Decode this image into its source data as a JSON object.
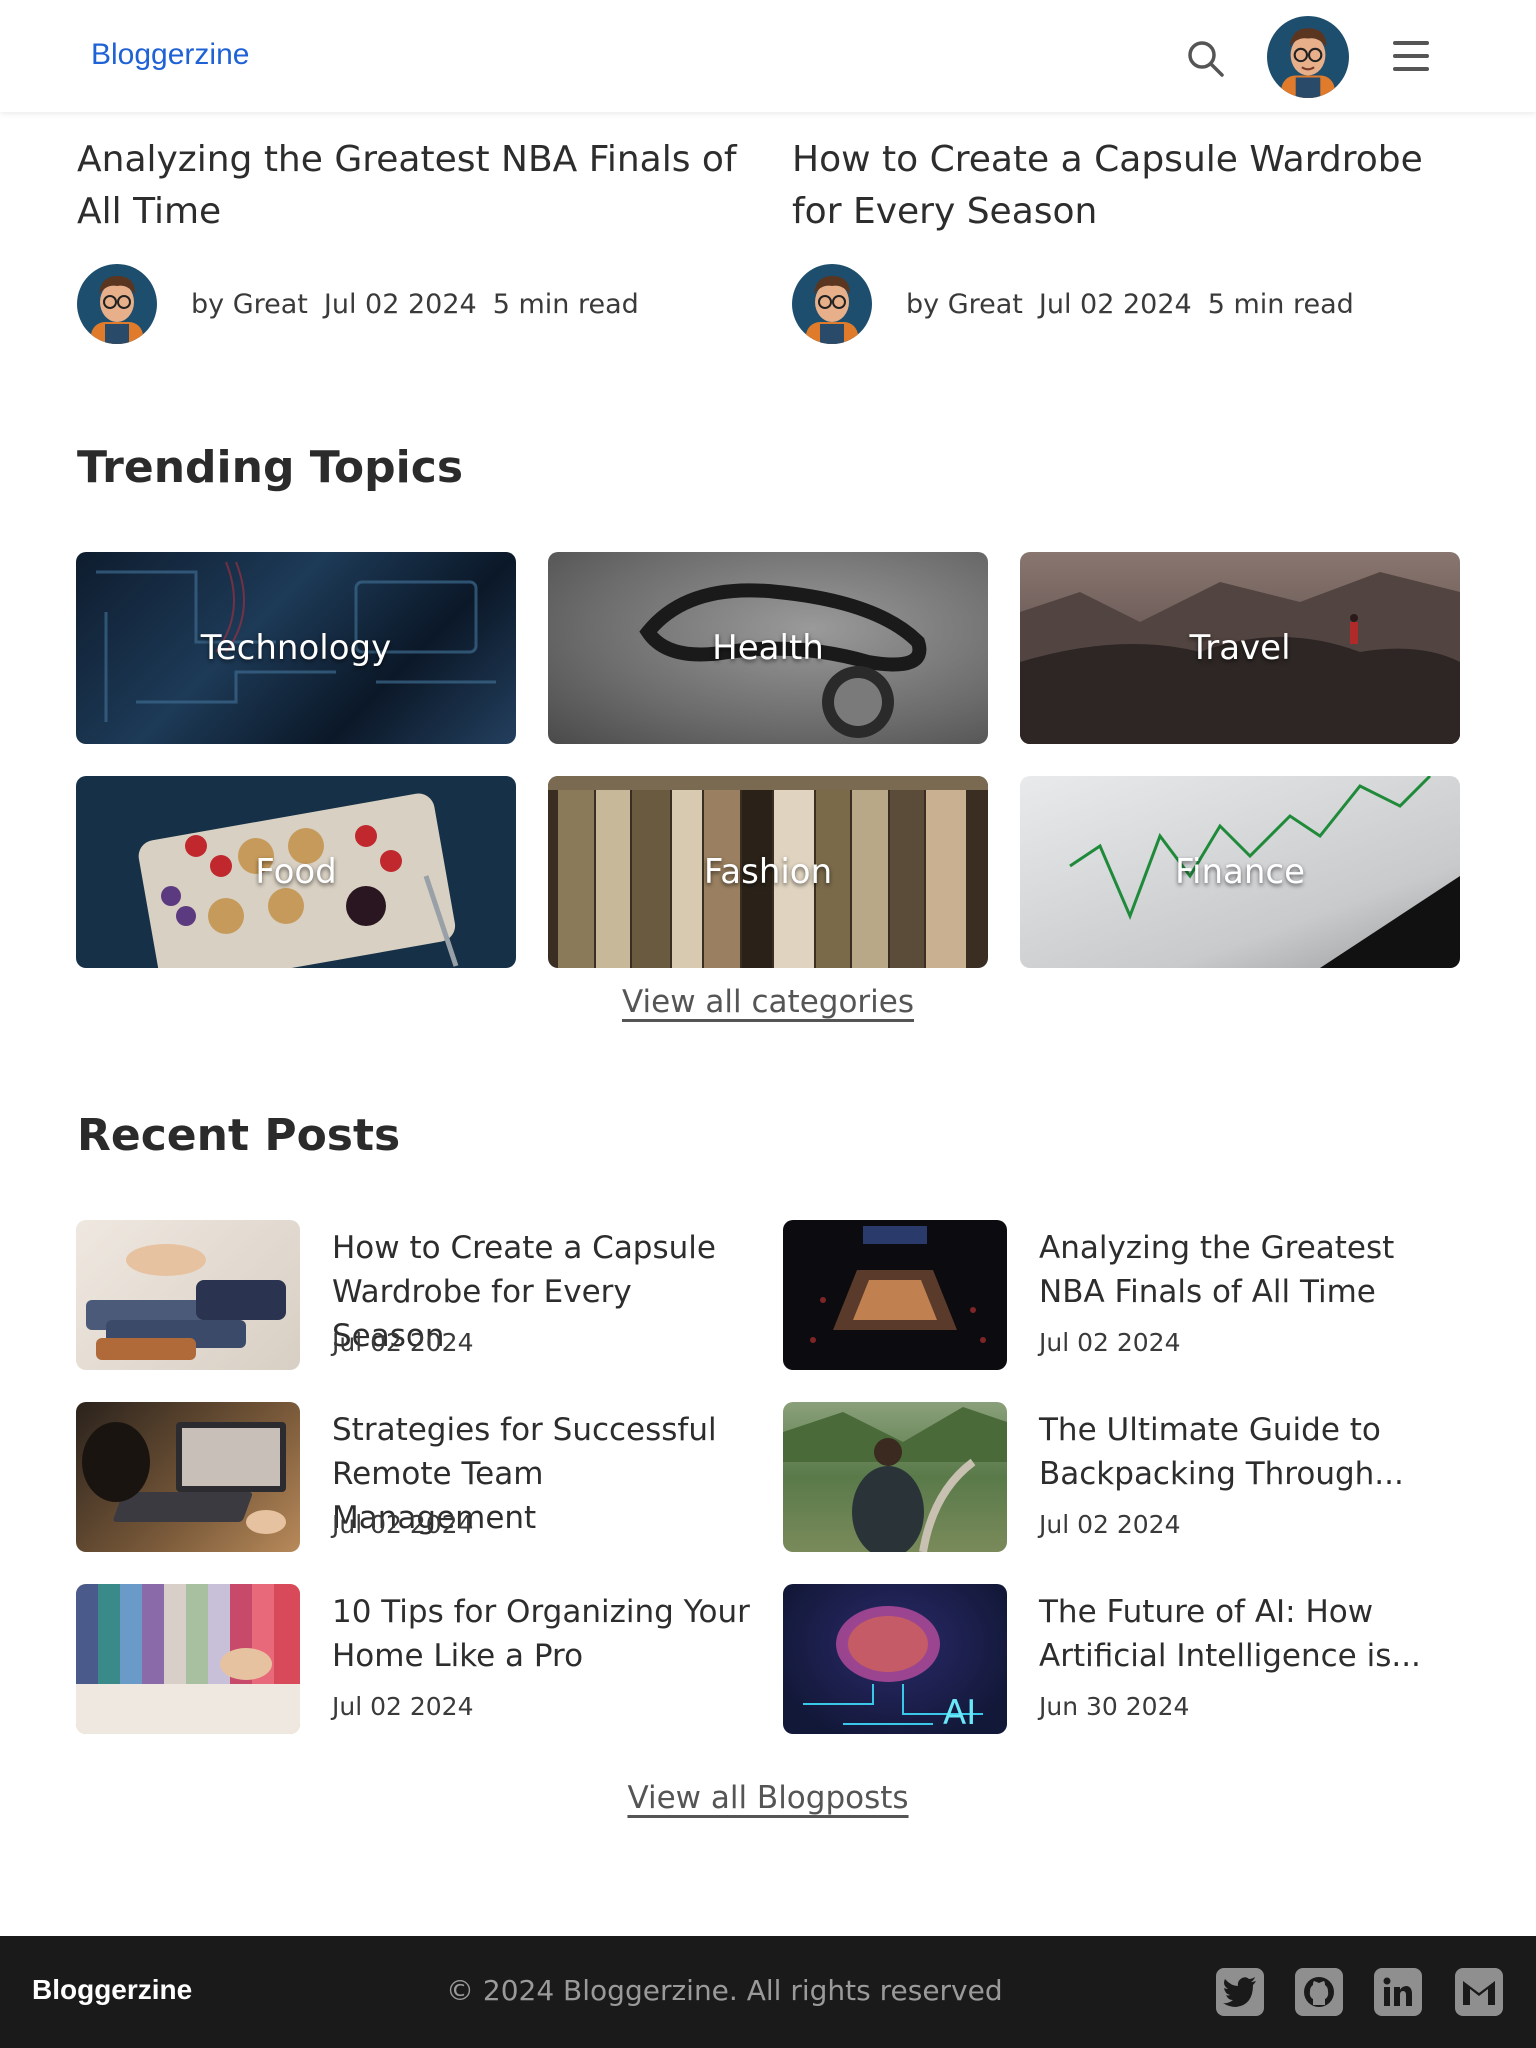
{
  "header": {
    "brand": "Bloggerzine",
    "icons": [
      "search-icon",
      "avatar",
      "hamburger-menu-icon"
    ]
  },
  "top_articles": [
    {
      "title": "Analyzing the Greatest NBA Finals of All Time",
      "author": "by Great",
      "date": "Jul 02 2024",
      "read_time": "5 min read"
    },
    {
      "title": "How to Create a Capsule Wardrobe for Every Season",
      "author": "by Great",
      "date": "Jul 02 2024",
      "read_time": "5 min read"
    }
  ],
  "trending": {
    "title": "Trending Topics",
    "topics": [
      "Technology",
      "Health",
      "Travel",
      "Food",
      "Fashion",
      "Finance"
    ],
    "view_all": "View all categories"
  },
  "recent": {
    "title": "Recent Posts",
    "posts": [
      {
        "title": "How to Create a Capsule Wardrobe for Every Season",
        "date": "Jul 02 2024"
      },
      {
        "title": "Analyzing the Greatest NBA Finals of All Time",
        "date": "Jul 02 2024"
      },
      {
        "title": "Strategies for Successful Remote Team Management",
        "date": "Jul 02 2024"
      },
      {
        "title": "The Ultimate Guide to Backpacking Through...",
        "date": "Jul 02 2024"
      },
      {
        "title": "10 Tips for Organizing Your Home Like a Pro",
        "date": "Jul 02 2024"
      },
      {
        "title": "The Future of AI: How Artificial Intelligence is...",
        "date": "Jun 30 2024"
      }
    ],
    "view_all": "View all Blogposts"
  },
  "footer": {
    "brand": "Bloggerzine",
    "copyright": "© 2024 Bloggerzine. All rights reserved",
    "social_icons": [
      "twitter-icon",
      "github-icon",
      "linkedin-icon",
      "gmail-icon"
    ]
  },
  "colors": {
    "brand": "#1f62d6",
    "footer_bg": "#1a1a1a",
    "social_icon": "#8f8f8f"
  }
}
